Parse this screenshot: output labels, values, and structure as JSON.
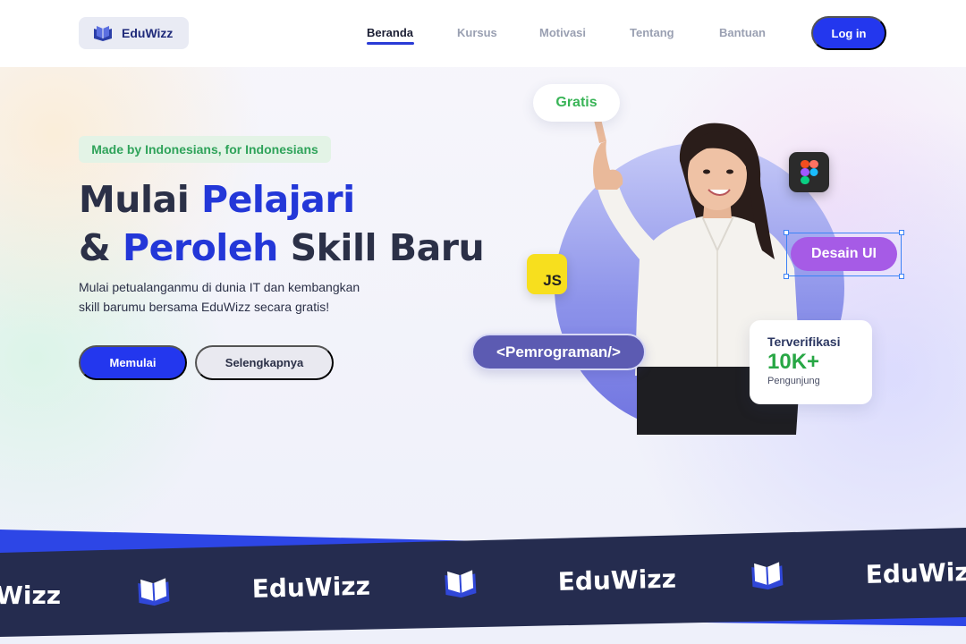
{
  "nav": {
    "logo_text": "EduWizz",
    "items": [
      {
        "label": "Beranda",
        "active": true
      },
      {
        "label": "Kursus",
        "active": false
      },
      {
        "label": "Motivasi",
        "active": false
      },
      {
        "label": "Tentang",
        "active": false
      },
      {
        "label": "Bantuan",
        "active": false
      }
    ],
    "login_label": "Log in"
  },
  "hero": {
    "tagline": "Made by Indonesians, for Indonesians",
    "headline": {
      "line1_plain": "Mulai ",
      "line1_accent": "Pelajari",
      "line2_prefix": "& ",
      "line2_accent": "Peroleh",
      "line2_suffix": " Skill Baru"
    },
    "subtext_line1": "Mulai petualanganmu di dunia IT dan kembangkan",
    "subtext_line2": "skill barumu bersama EduWizz secara gratis!",
    "primary_button": "Memulai",
    "secondary_button": "Selengkapnya"
  },
  "visual": {
    "chip_gratis": "Gratis",
    "chip_desain": "Desain UI",
    "chip_programming": "<Pemrograman/>",
    "js_badge": "JS",
    "figma_icon": "figma-icon",
    "stats_card": {
      "title": "Terverifikasi",
      "value": "10K+",
      "label": "Pengunjung"
    }
  },
  "banner": {
    "brand": "EduWizz",
    "brand_partial": "Wizz",
    "icon": "book-icon"
  },
  "colors": {
    "primary": "#2337ee",
    "accent_text": "#2337d8",
    "green": "#28a745",
    "purple_chip": "#a65be6",
    "banner_dark": "#252c4f"
  }
}
